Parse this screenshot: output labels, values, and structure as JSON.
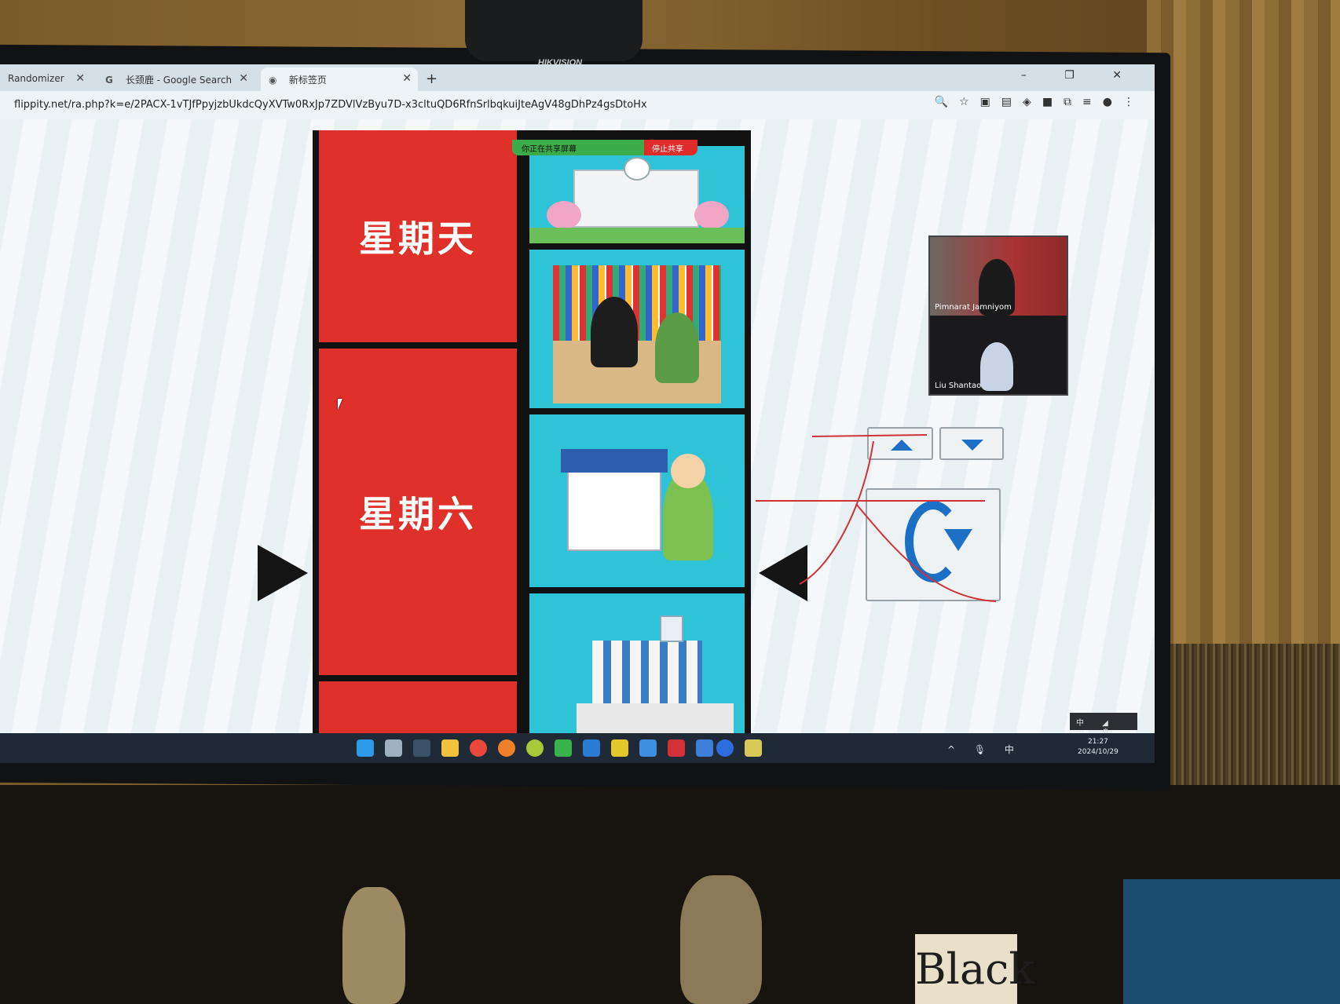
{
  "hardware": {
    "webcam_brand": "HIKVISION",
    "book_text": "Black"
  },
  "browser": {
    "tabs": [
      {
        "label": "Randomizer",
        "icon": "page-icon",
        "active": false
      },
      {
        "label": "长颈鹿 - Google Search",
        "icon": "google-icon",
        "active": false
      },
      {
        "label": "新标签页",
        "icon": "chrome-icon",
        "active": true
      }
    ],
    "new_tab": "+",
    "url": "flippity.net/ra.php?k=e/2PACX-1vTJfPpyjzbUkdcQyXVTw0RxJp7ZDVlVzByu7D-x3cltuQD6RfnSrlbqkuiJteAgV48gDhPz4gsDtoHx",
    "window_controls": [
      "–",
      "❐",
      "✕"
    ],
    "toolbar_icons": [
      "zoom-icon",
      "bookmark-star-icon",
      "translate-icon",
      "extension-icon",
      "extension-icon",
      "extension-icon",
      "extension-icon",
      "puzzle-icon",
      "media-icon",
      "profile-icon",
      "menu-icon"
    ]
  },
  "share_banner": {
    "sharing_text": "你正在共享屏幕",
    "stop_text": "停止共享"
  },
  "randomizer": {
    "reel_labels": [
      "星期天",
      "星期六"
    ],
    "images": [
      "school-building-image",
      "library-reading-image",
      "house-boy-image",
      "airport-image"
    ],
    "up_button": "up-arrow-icon",
    "down_button": "down-arrow-icon",
    "spin_button": "spin-refresh-icon",
    "accent": "#1b6fc4",
    "reel_color": "#e0302a"
  },
  "video": {
    "participants": [
      {
        "name": "Pimnarat Jamniyom"
      },
      {
        "name": "Liu Shantao"
      }
    ]
  },
  "zoom_mini_controls": "中 ◢ ⋯ ⚙",
  "taskbar": {
    "tray_text": "^ 🎙 中",
    "time": "21:27",
    "date": "2024/10/29"
  },
  "annotation": {
    "ink_color": "#d2313a",
    "handwritten_char": "天"
  }
}
